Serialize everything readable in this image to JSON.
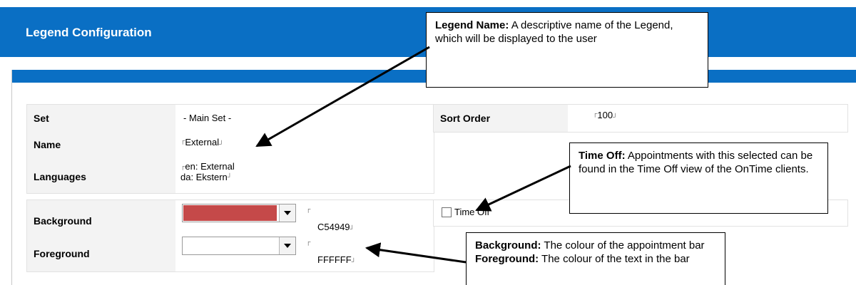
{
  "header": {
    "title": "Legend Configuration",
    "color": "#0a6fc4"
  },
  "form": {
    "set": {
      "label": "Set",
      "value": "- Main Set -"
    },
    "name": {
      "label": "Name",
      "value": "External"
    },
    "languages": {
      "label": "Languages",
      "line1": "en: External",
      "line2": "da: Ekstern"
    },
    "background": {
      "label": "Background",
      "color": "#C54949",
      "hex": "C54949"
    },
    "foreground": {
      "label": "Foreground",
      "color": "#FFFFFF",
      "hex": "FFFFFF"
    },
    "sort_order": {
      "label": "Sort Order",
      "value": "100"
    },
    "time_off": {
      "label": "Time Off",
      "checked": false
    }
  },
  "callouts": {
    "legend_name": {
      "bold": "Legend Name:",
      "text": " A descriptive name of the Legend, which will be displayed to the user"
    },
    "time_off": {
      "bold": "Time Off:",
      "text": " Appointments with this selected can be found in the Time Off view of the OnTime clients."
    },
    "colours": {
      "bg_bold": "Background:",
      "bg_text": " The colour of the appointment bar",
      "fg_bold": "Foreground:",
      "fg_text": " The colour of the text in the bar"
    }
  }
}
